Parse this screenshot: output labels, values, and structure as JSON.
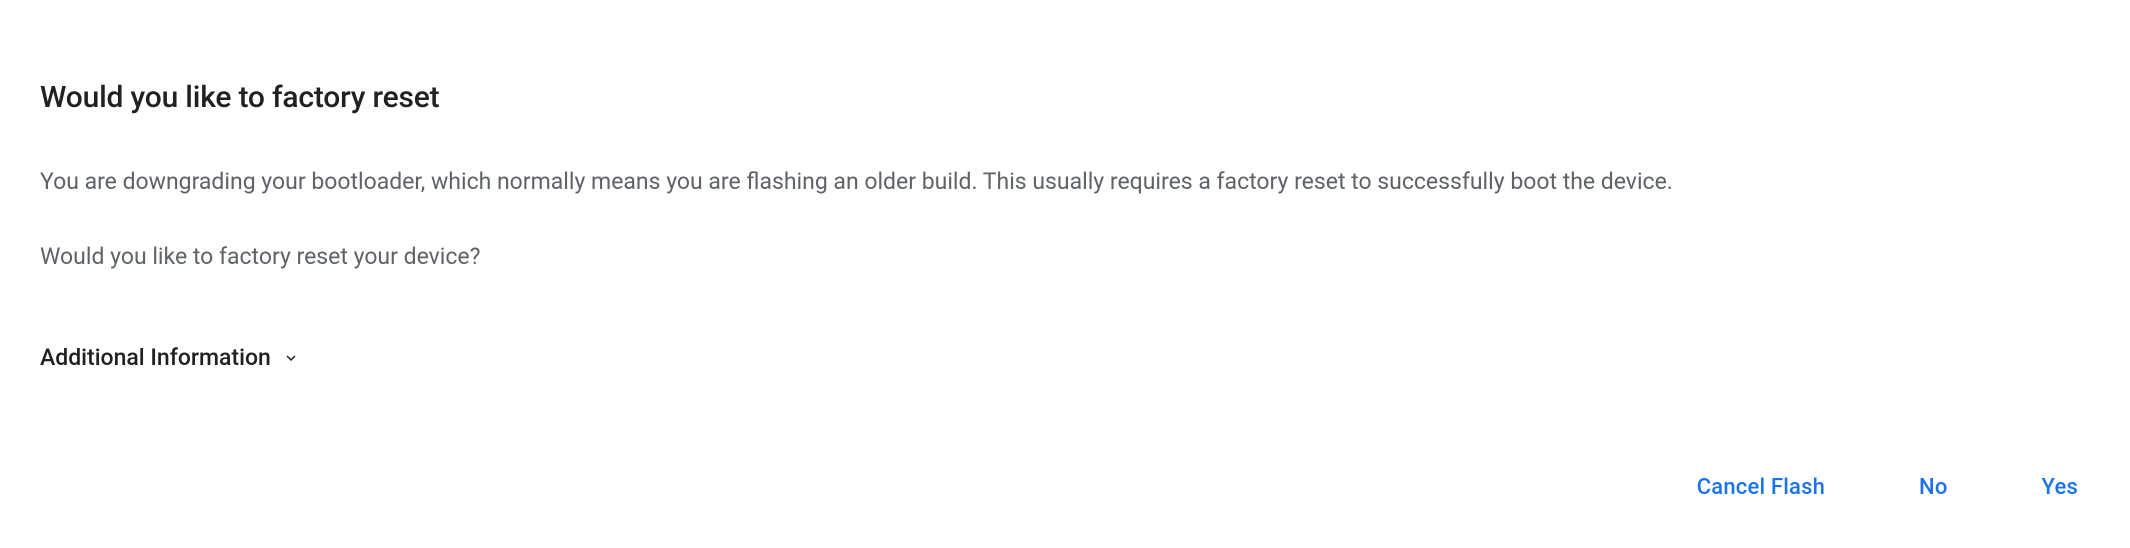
{
  "dialog": {
    "title": "Would you like to factory reset",
    "body_line1": "You are downgrading your bootloader, which normally means you are flashing an older build. This usually requires a factory reset to successfully boot the device.",
    "body_line2": "Would you like to factory reset your device?",
    "expander_label": "Additional Information"
  },
  "buttons": {
    "cancel": "Cancel Flash",
    "no": "No",
    "yes": "Yes"
  },
  "colors": {
    "primary_text": "#202124",
    "secondary_text": "#5f6368",
    "accent": "#1a73e8"
  }
}
